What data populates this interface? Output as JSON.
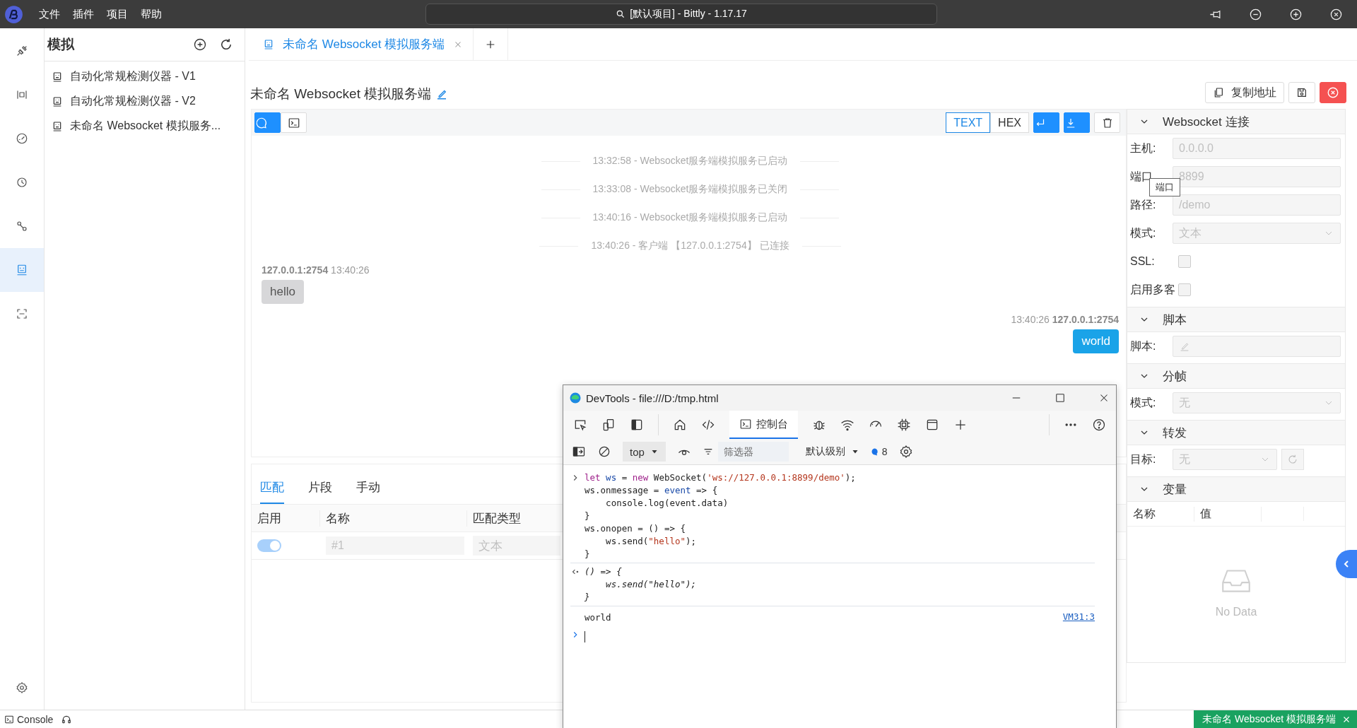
{
  "menu_bar": {
    "items": [
      "文件",
      "插件",
      "项目",
      "帮助"
    ],
    "search": "[默认项目] - Bittly - 1.17.17"
  },
  "activity_bar": [
    {
      "selected": false
    },
    {
      "selected": false
    },
    {
      "selected": false
    },
    {
      "selected": false
    },
    {
      "selected": false
    },
    {
      "selected": true
    },
    {
      "selected": false
    }
  ],
  "sidebar": {
    "title": "模拟",
    "items": [
      "自动化常规检测仪器 - V1",
      "自动化常规检测仪器 - V2",
      "未命名 Websocket 模拟服务..."
    ]
  },
  "tabs": [
    {
      "label": "未命名 Websocket 模拟服务端",
      "selected": true
    }
  ],
  "page": {
    "title": "未命名 Websocket 模拟服务端",
    "copy_button": "复制地址"
  },
  "chat": {
    "view_modes": [
      {
        "selected": true
      },
      {
        "selected": false
      }
    ],
    "formats": [
      {
        "label": "TEXT",
        "selected": true
      },
      {
        "label": "HEX",
        "selected": false
      }
    ],
    "toggles": [
      {
        "on": true
      },
      {
        "on": true
      }
    ],
    "events": [
      "13:32:58 - Websocket服务端模拟服务已启动",
      "13:33:08 - Websocket服务端模拟服务已关闭",
      "13:40:16 - Websocket服务端模拟服务已启动",
      "13:40:26 - 客户端 【127.0.0.1:2754】 已连接"
    ],
    "messages": [
      {
        "kind": "incoming",
        "sender": "127.0.0.1:2754",
        "time": "13:40:26",
        "text": "hello"
      },
      {
        "kind": "outgoing",
        "sender": "127.0.0.1:2754",
        "time": "13:40:26",
        "text": "world"
      }
    ]
  },
  "rules": {
    "tabs": [
      {
        "label": "匹配",
        "selected": true
      },
      {
        "label": "片段",
        "selected": false
      },
      {
        "label": "手动",
        "selected": false
      }
    ],
    "columns": [
      "启用",
      "名称",
      "匹配类型"
    ],
    "rows": [
      {
        "enabled": true,
        "placeholder": "#1",
        "type": "文本"
      }
    ]
  },
  "settings": {
    "sections": [
      {
        "title": "Websocket 连接",
        "expanded": true,
        "fields": [
          {
            "kind": "input",
            "label": "主机:",
            "value": "0.0.0.0",
            "disabled": true
          },
          {
            "kind": "input",
            "label": "端口",
            "value": "8899",
            "disabled": true
          },
          {
            "kind": "input",
            "label": "路径:",
            "value": "/demo",
            "disabled": true
          },
          {
            "kind": "select",
            "label": "模式:",
            "value": "文本",
            "disabled": true
          },
          {
            "kind": "checkbox",
            "label": "SSL:",
            "checked": false,
            "disabled": true
          },
          {
            "kind": "checkbox",
            "label": "启用多客",
            "checked": false,
            "disabled": true
          }
        ]
      },
      {
        "title": "脚本",
        "expanded": true,
        "fields": [
          {
            "kind": "script",
            "label": "脚本:",
            "disabled": true
          }
        ]
      },
      {
        "title": "分帧",
        "expanded": true,
        "fields": [
          {
            "kind": "select",
            "label": "模式:",
            "value": "无",
            "disabled": true
          }
        ]
      },
      {
        "title": "转发",
        "expanded": true,
        "fields": [
          {
            "kind": "select_refresh",
            "label": "目标:",
            "value": "无",
            "disabled": true
          }
        ]
      },
      {
        "title": "变量",
        "expanded": true,
        "table": {
          "columns": [
            "名称",
            "值"
          ],
          "empty": "No Data"
        }
      }
    ]
  },
  "tooltip": "端口",
  "devtools": {
    "title": "DevTools - file:///D:/tmp.html",
    "tabs": [
      {
        "label": "控制台",
        "selected": true
      }
    ],
    "context": "top",
    "filter_placeholder": "筛选器",
    "level": "默认级别",
    "message_count": "8",
    "console": [
      {
        "kind": "input",
        "lines": [
          [
            {
              "t": "let ",
              "kind": "keyword"
            },
            {
              "t": "ws",
              "kind": "variable"
            },
            {
              "t": " = ",
              "kind": "plain"
            },
            {
              "t": "new ",
              "kind": "keyword"
            },
            {
              "t": "WebSocket(",
              "kind": "plain"
            },
            {
              "t": "'ws://127.0.0.1:8899/demo'",
              "kind": "string"
            },
            {
              "t": ");",
              "kind": "plain"
            }
          ],
          [
            {
              "t": "ws.onmessage = ",
              "kind": "plain"
            },
            {
              "t": "event",
              "kind": "variable"
            },
            {
              "t": " => {",
              "kind": "plain"
            }
          ],
          [
            {
              "t": "    console.log(event.data)",
              "kind": "plain"
            }
          ],
          [
            {
              "t": "}",
              "kind": "plain"
            }
          ],
          [
            {
              "t": "ws.onopen = () => {",
              "kind": "plain"
            }
          ],
          [
            {
              "t": "    ws.send(",
              "kind": "plain"
            },
            {
              "t": "\"hello\"",
              "kind": "string"
            },
            {
              "t": ");",
              "kind": "plain"
            }
          ],
          [
            {
              "t": "}",
              "kind": "plain"
            }
          ]
        ]
      },
      {
        "kind": "result",
        "lines": [
          [
            {
              "t": "() => {",
              "kind": "plain"
            }
          ],
          [
            {
              "t": "    ws.send(\"hello\");",
              "kind": "plain"
            }
          ],
          [
            {
              "t": "}",
              "kind": "plain"
            }
          ]
        ]
      },
      {
        "kind": "log",
        "text": "world",
        "source": "VM31:3"
      },
      {
        "kind": "prompt"
      }
    ]
  },
  "status_bar": {
    "console": "Console",
    "open_tab": "未命名 Websocket 模拟服务端"
  }
}
